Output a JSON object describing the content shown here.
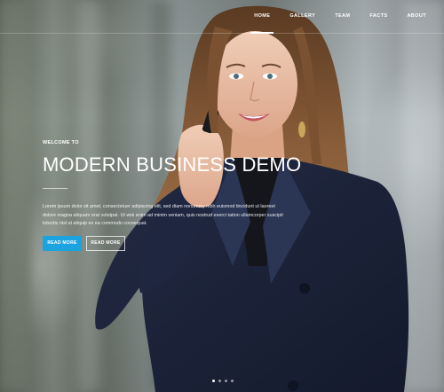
{
  "nav": {
    "items": [
      {
        "label": "HOME",
        "active": true
      },
      {
        "label": "GALLERY",
        "active": false
      },
      {
        "label": "TEAM",
        "active": false
      },
      {
        "label": "FACTS",
        "active": false
      },
      {
        "label": "ABOUT",
        "active": false
      }
    ]
  },
  "hero": {
    "eyebrow": "WELCOME TO",
    "headline": "MODERN BUSINESS DEMO",
    "body": "Lorem ipsum dolor sit amet, consectetuer adipiscing elit, sed diam nonummy nibh euismod tincidunt ut laoreet dolore magna aliquam erat volutpat. Ut wisi enim ad minim veniam, quis nostrud exerci tation ullamcorper suscipit lobortis nisl ut aliquip ex ea commodo consequat.",
    "primary_button": "READ MORE",
    "secondary_button": "READ MORE"
  },
  "slider": {
    "slide_count": 4,
    "active_index": 0
  },
  "colors": {
    "accent": "#1ba3e0",
    "text": "#ffffff",
    "suit": "#1c2338",
    "hair": "#6b4428"
  }
}
